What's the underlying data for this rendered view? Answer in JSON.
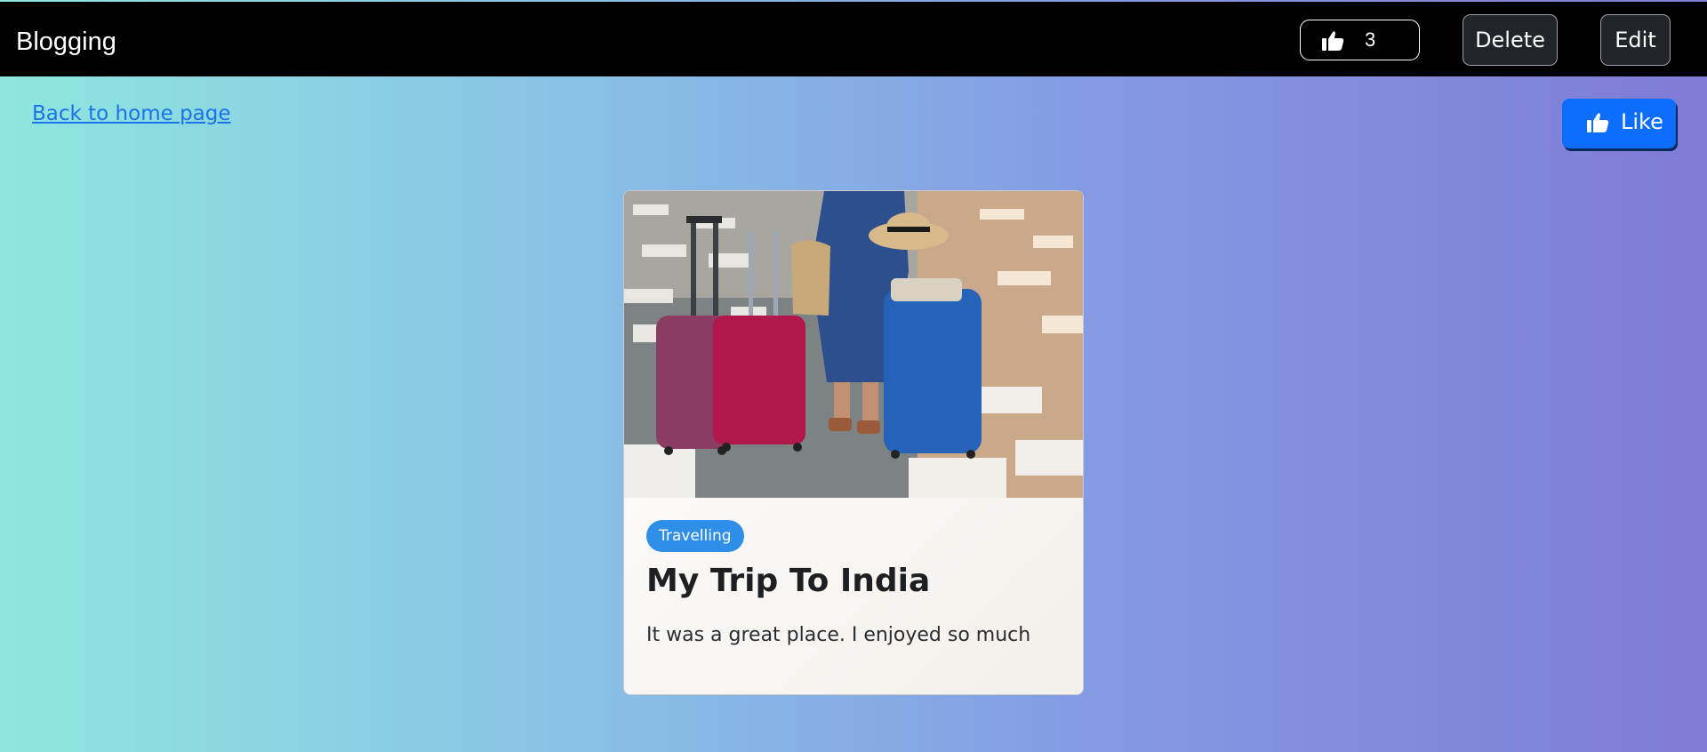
{
  "navbar": {
    "brand": "Blogging",
    "like_count": "3",
    "like_icon": "thumbs-up-icon",
    "delete_label": "Delete",
    "edit_label": "Edit"
  },
  "page": {
    "back_link": "Back to home page",
    "like_button": "Like",
    "like_icon": "thumbs-up-icon"
  },
  "post": {
    "image_subject": "woman with luggage at airport",
    "category": "Travelling",
    "title": "My Trip To India",
    "body": "It was a great place. I enjoyed so much"
  },
  "colors": {
    "navbar_bg": "#000000",
    "primary": "#0d6efd",
    "badge": "#2e8ee8",
    "gradient_start": "#8ee6de",
    "gradient_end": "#7f7bd6"
  }
}
